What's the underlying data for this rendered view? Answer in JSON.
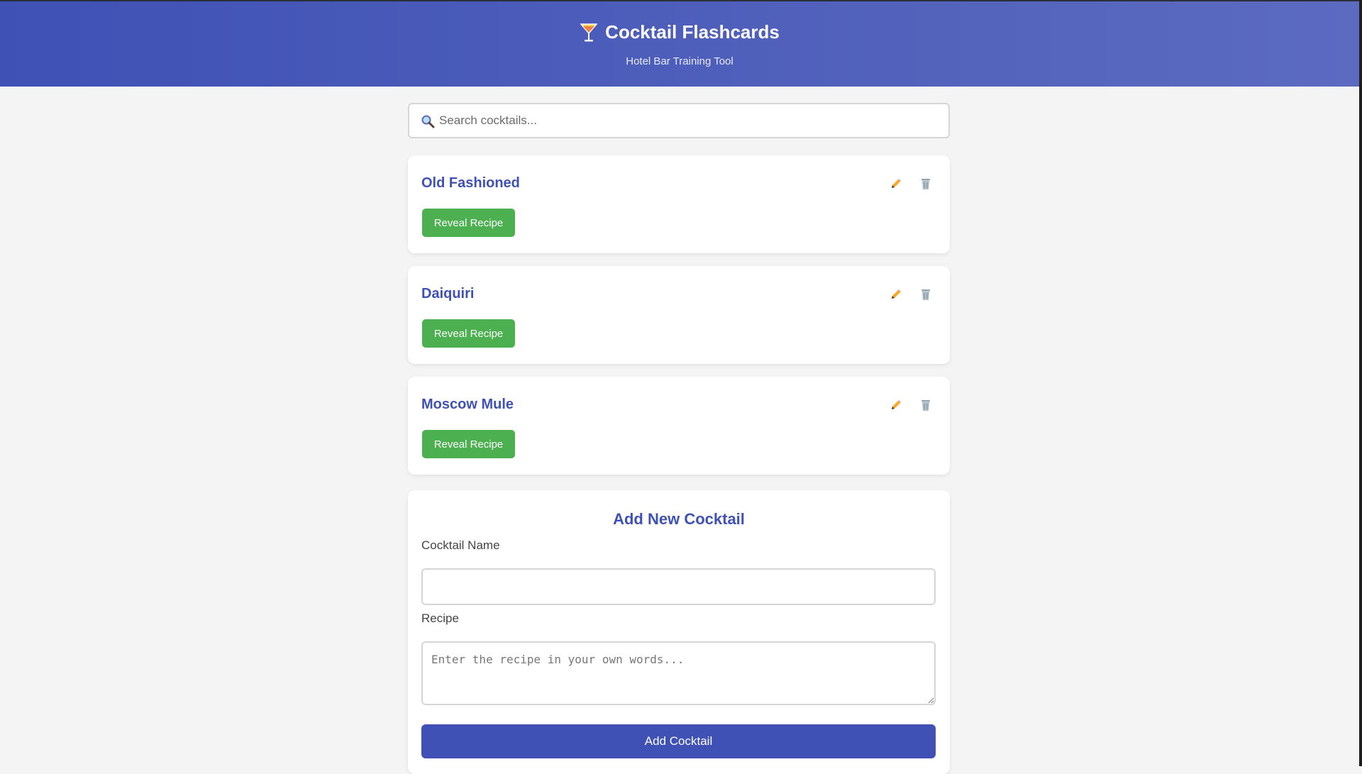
{
  "header": {
    "title": "Cocktail Flashcards",
    "subtitle": "Hotel Bar Training Tool",
    "icon": "cocktail-glass-icon"
  },
  "search": {
    "placeholder": "Search cocktails...",
    "value": "",
    "icon": "search-icon"
  },
  "cards": [
    {
      "name": "Old Fashioned",
      "reveal_label": "Reveal Recipe",
      "edit_icon": "pencil-icon",
      "delete_icon": "trash-icon"
    },
    {
      "name": "Daiquiri",
      "reveal_label": "Reveal Recipe",
      "edit_icon": "pencil-icon",
      "delete_icon": "trash-icon"
    },
    {
      "name": "Moscow Mule",
      "reveal_label": "Reveal Recipe",
      "edit_icon": "pencil-icon",
      "delete_icon": "trash-icon"
    }
  ],
  "form": {
    "title": "Add New Cocktail",
    "name_label": "Cocktail Name",
    "name_value": "",
    "recipe_label": "Recipe",
    "recipe_placeholder": "Enter the recipe in your own words...",
    "recipe_value": "",
    "submit_label": "Add Cocktail"
  },
  "colors": {
    "primary": "#3f51b5",
    "header_gradient_end": "#5c6bc0",
    "success": "#4caf50",
    "background": "#f4f4f4"
  }
}
